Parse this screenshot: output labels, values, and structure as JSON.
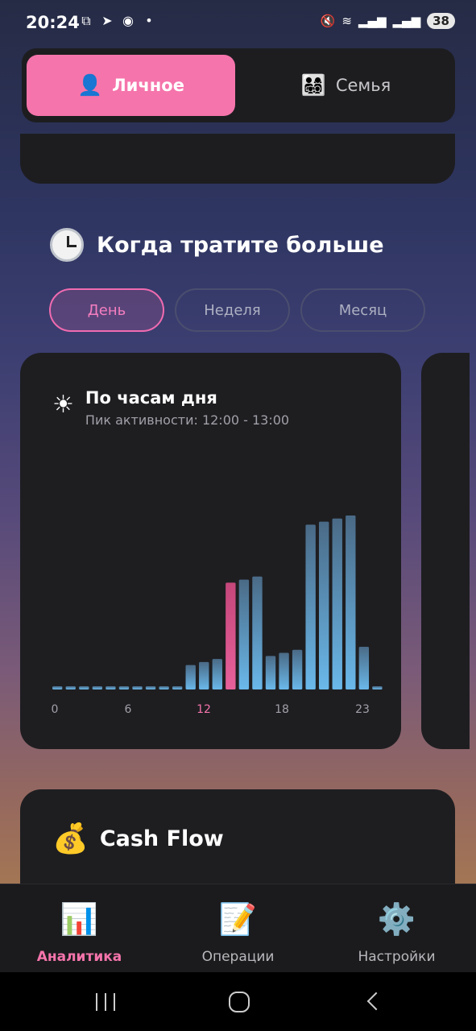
{
  "status": {
    "time": "20:24",
    "battery": "38",
    "left_icons": [
      "screenshot-icon",
      "telegram-icon",
      "app-icon",
      "dot-icon"
    ],
    "right_icons": [
      "mute-icon",
      "wifi-icon",
      "signal-icon",
      "signal-icon"
    ]
  },
  "tabs": {
    "personal": {
      "label": "Личное",
      "icon": "👤"
    },
    "family": {
      "label": "Семья",
      "icon": "👨‍👩‍👧‍👦"
    }
  },
  "section": {
    "icon": "🕐",
    "title": "Когда тратите больше"
  },
  "periods": [
    {
      "label": "День",
      "active": true
    },
    {
      "label": "Неделя",
      "active": false
    },
    {
      "label": "Месяц",
      "active": false
    }
  ],
  "hourly_card": {
    "icon": "☀",
    "title": "По часам дня",
    "subtitle": "Пик активности: 12:00 - 13:00"
  },
  "chart_data": {
    "type": "bar",
    "x": [
      0,
      1,
      2,
      3,
      4,
      5,
      6,
      7,
      8,
      9,
      10,
      11,
      12,
      13,
      14,
      15,
      16,
      17,
      18,
      19,
      20,
      21,
      22,
      23
    ],
    "values": [
      1,
      1,
      1,
      1,
      1,
      1,
      1,
      1,
      1,
      1,
      8,
      9,
      10,
      35,
      36,
      37,
      11,
      12,
      13,
      54,
      55,
      56,
      57,
      14,
      1
    ],
    "tick_labels": [
      "0",
      "6",
      "12",
      "18",
      "23"
    ],
    "highlight_index": 12,
    "colors": {
      "bar": "#69b4e3",
      "highlight": "#e0578f",
      "tick": "#a0a0a8",
      "tick_highlight": "#f574ab"
    }
  },
  "cash_card": {
    "icon": "💰",
    "title": "Cash Flow"
  },
  "bottom_nav": [
    {
      "icon": "📊",
      "label": "Аналитика",
      "active": true
    },
    {
      "icon": "📝",
      "label": "Операции",
      "active": false
    },
    {
      "icon": "⚙️",
      "label": "Настройки",
      "active": false
    }
  ]
}
